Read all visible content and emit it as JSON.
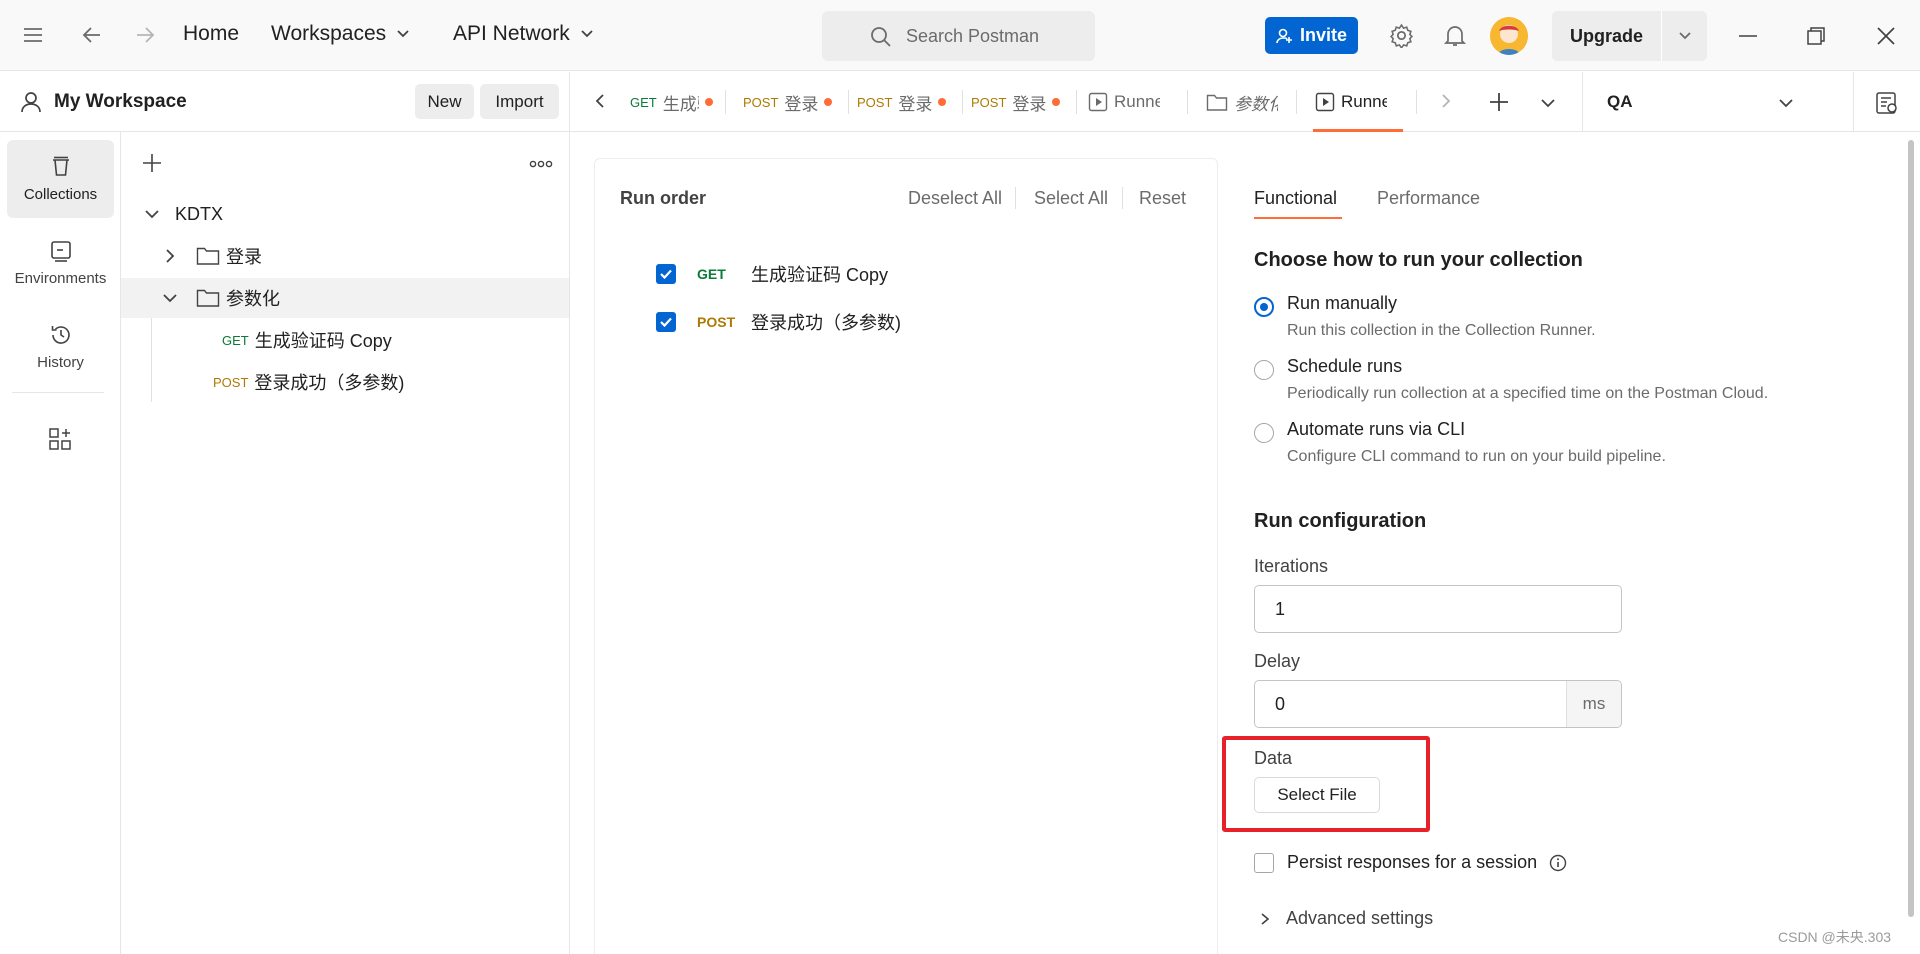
{
  "topbar": {
    "home": "Home",
    "workspaces": "Workspaces",
    "api_network": "API Network",
    "search_placeholder": "Search Postman",
    "invite": "Invite",
    "upgrade": "Upgrade"
  },
  "workspace": {
    "name": "My Workspace",
    "new": "New",
    "import": "Import"
  },
  "tabs": [
    {
      "method": "GET",
      "label": "生成验"
    },
    {
      "method": "POST",
      "label": "登录"
    },
    {
      "method": "POST",
      "label": "登录"
    },
    {
      "method": "POST",
      "label": "登录"
    },
    {
      "method": "",
      "label": "Runne"
    },
    {
      "method": "",
      "label": "参数化"
    },
    {
      "method": "",
      "label": "Runne"
    }
  ],
  "environment": "QA",
  "rail": {
    "collections": "Collections",
    "environments": "Environments",
    "history": "History"
  },
  "tree": {
    "collection": "KDTX",
    "folder1": "登录",
    "folder2": "参数化",
    "req1_method": "GET",
    "req1_name": "生成验证码 Copy",
    "req2_method": "POST",
    "req2_name": "登录成功（多参数)"
  },
  "run_order": {
    "title": "Run order",
    "deselect_all": "Deselect All",
    "select_all": "Select All",
    "reset": "Reset",
    "items": [
      {
        "method": "GET",
        "name": "生成验证码 Copy",
        "checked": true
      },
      {
        "method": "POST",
        "name": "登录成功（多参数)",
        "checked": true
      }
    ]
  },
  "config": {
    "tab_functional": "Functional",
    "tab_performance": "Performance",
    "heading": "Choose how to run your collection",
    "options": [
      {
        "title": "Run manually",
        "desc": "Run this collection in the Collection Runner.",
        "selected": true
      },
      {
        "title": "Schedule runs",
        "desc": "Periodically run collection at a specified time on the Postman Cloud.",
        "selected": false
      },
      {
        "title": "Automate runs via CLI",
        "desc": "Configure CLI command to run on your build pipeline.",
        "selected": false
      }
    ],
    "run_config_heading": "Run configuration",
    "iterations_label": "Iterations",
    "iterations_value": "1",
    "delay_label": "Delay",
    "delay_value": "0",
    "delay_unit": "ms",
    "data_label": "Data",
    "select_file": "Select File",
    "persist_label": "Persist responses for a session",
    "advanced": "Advanced settings"
  },
  "watermark": "CSDN @未央.303",
  "colors": {
    "accent": "#0265d2",
    "orange": "#ff6c37",
    "highlight_box": "#e8202a"
  }
}
